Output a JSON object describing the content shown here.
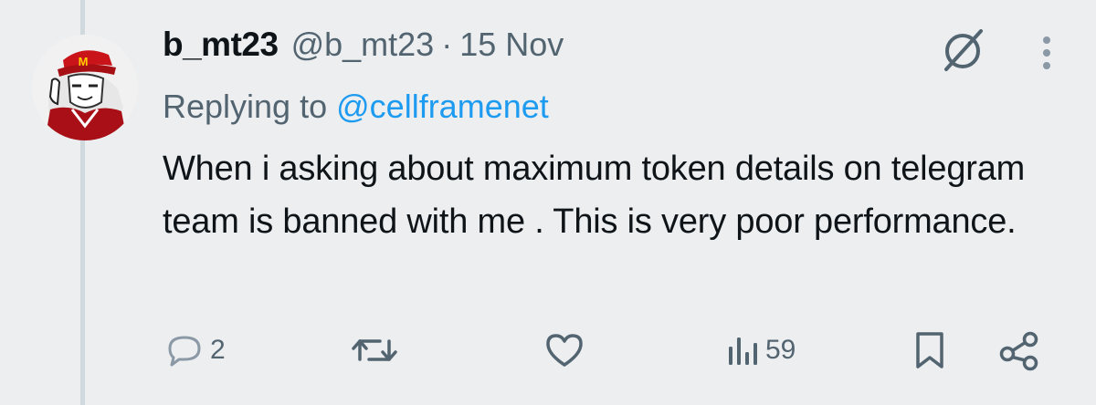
{
  "tweet": {
    "display_name": "b_mt23",
    "handle": "@b_mt23",
    "separator": "·",
    "timestamp": "15 Nov",
    "replying_prefix": "Replying to",
    "replying_to": "@cellframenet",
    "text": "When i asking about maximum token details on telegram team is banned with me . This is very poor performance.",
    "avatar_text": "M"
  },
  "actions": {
    "replies": "2",
    "reposts": "",
    "likes": "",
    "views": "59"
  },
  "colors": {
    "background": "#eceef0",
    "accent": "#1d9bf0",
    "muted": "#536471",
    "muted_light": "#8b98a5"
  },
  "icons": {
    "top_right": [
      "grok-slash-icon",
      "more-vertical-icon"
    ],
    "actions": [
      "reply-icon",
      "repost-icon",
      "like-icon",
      "views-icon",
      "bookmark-icon",
      "share-icon"
    ]
  }
}
